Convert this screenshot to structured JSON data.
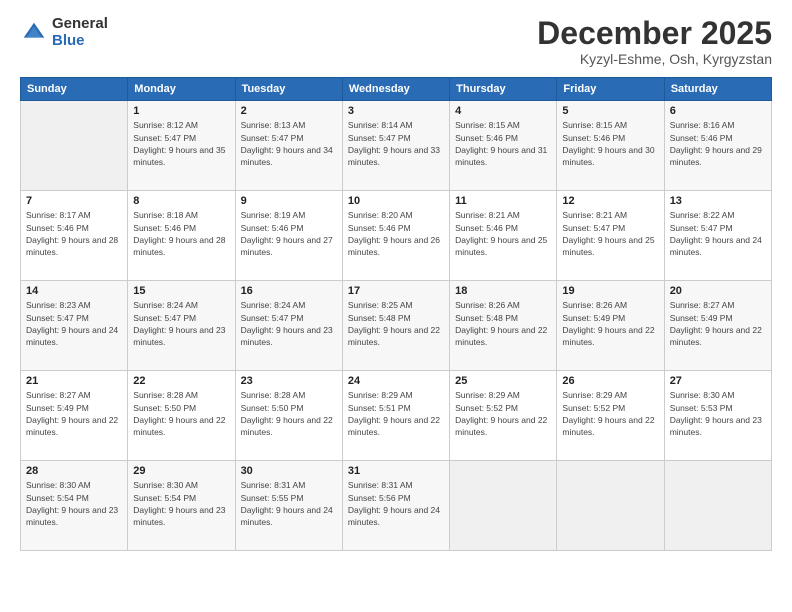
{
  "header": {
    "logo_general": "General",
    "logo_blue": "Blue",
    "title": "December 2025",
    "subtitle": "Kyzyl-Eshme, Osh, Kyrgyzstan"
  },
  "days_of_week": [
    "Sunday",
    "Monday",
    "Tuesday",
    "Wednesday",
    "Thursday",
    "Friday",
    "Saturday"
  ],
  "weeks": [
    [
      {
        "day": "",
        "sunrise": "",
        "sunset": "",
        "daylight": "",
        "empty": true
      },
      {
        "day": "1",
        "sunrise": "Sunrise: 8:12 AM",
        "sunset": "Sunset: 5:47 PM",
        "daylight": "Daylight: 9 hours and 35 minutes."
      },
      {
        "day": "2",
        "sunrise": "Sunrise: 8:13 AM",
        "sunset": "Sunset: 5:47 PM",
        "daylight": "Daylight: 9 hours and 34 minutes."
      },
      {
        "day": "3",
        "sunrise": "Sunrise: 8:14 AM",
        "sunset": "Sunset: 5:47 PM",
        "daylight": "Daylight: 9 hours and 33 minutes."
      },
      {
        "day": "4",
        "sunrise": "Sunrise: 8:15 AM",
        "sunset": "Sunset: 5:46 PM",
        "daylight": "Daylight: 9 hours and 31 minutes."
      },
      {
        "day": "5",
        "sunrise": "Sunrise: 8:15 AM",
        "sunset": "Sunset: 5:46 PM",
        "daylight": "Daylight: 9 hours and 30 minutes."
      },
      {
        "day": "6",
        "sunrise": "Sunrise: 8:16 AM",
        "sunset": "Sunset: 5:46 PM",
        "daylight": "Daylight: 9 hours and 29 minutes."
      }
    ],
    [
      {
        "day": "7",
        "sunrise": "Sunrise: 8:17 AM",
        "sunset": "Sunset: 5:46 PM",
        "daylight": "Daylight: 9 hours and 28 minutes."
      },
      {
        "day": "8",
        "sunrise": "Sunrise: 8:18 AM",
        "sunset": "Sunset: 5:46 PM",
        "daylight": "Daylight: 9 hours and 28 minutes."
      },
      {
        "day": "9",
        "sunrise": "Sunrise: 8:19 AM",
        "sunset": "Sunset: 5:46 PM",
        "daylight": "Daylight: 9 hours and 27 minutes."
      },
      {
        "day": "10",
        "sunrise": "Sunrise: 8:20 AM",
        "sunset": "Sunset: 5:46 PM",
        "daylight": "Daylight: 9 hours and 26 minutes."
      },
      {
        "day": "11",
        "sunrise": "Sunrise: 8:21 AM",
        "sunset": "Sunset: 5:46 PM",
        "daylight": "Daylight: 9 hours and 25 minutes."
      },
      {
        "day": "12",
        "sunrise": "Sunrise: 8:21 AM",
        "sunset": "Sunset: 5:47 PM",
        "daylight": "Daylight: 9 hours and 25 minutes."
      },
      {
        "day": "13",
        "sunrise": "Sunrise: 8:22 AM",
        "sunset": "Sunset: 5:47 PM",
        "daylight": "Daylight: 9 hours and 24 minutes."
      }
    ],
    [
      {
        "day": "14",
        "sunrise": "Sunrise: 8:23 AM",
        "sunset": "Sunset: 5:47 PM",
        "daylight": "Daylight: 9 hours and 24 minutes."
      },
      {
        "day": "15",
        "sunrise": "Sunrise: 8:24 AM",
        "sunset": "Sunset: 5:47 PM",
        "daylight": "Daylight: 9 hours and 23 minutes."
      },
      {
        "day": "16",
        "sunrise": "Sunrise: 8:24 AM",
        "sunset": "Sunset: 5:47 PM",
        "daylight": "Daylight: 9 hours and 23 minutes."
      },
      {
        "day": "17",
        "sunrise": "Sunrise: 8:25 AM",
        "sunset": "Sunset: 5:48 PM",
        "daylight": "Daylight: 9 hours and 22 minutes."
      },
      {
        "day": "18",
        "sunrise": "Sunrise: 8:26 AM",
        "sunset": "Sunset: 5:48 PM",
        "daylight": "Daylight: 9 hours and 22 minutes."
      },
      {
        "day": "19",
        "sunrise": "Sunrise: 8:26 AM",
        "sunset": "Sunset: 5:49 PM",
        "daylight": "Daylight: 9 hours and 22 minutes."
      },
      {
        "day": "20",
        "sunrise": "Sunrise: 8:27 AM",
        "sunset": "Sunset: 5:49 PM",
        "daylight": "Daylight: 9 hours and 22 minutes."
      }
    ],
    [
      {
        "day": "21",
        "sunrise": "Sunrise: 8:27 AM",
        "sunset": "Sunset: 5:49 PM",
        "daylight": "Daylight: 9 hours and 22 minutes."
      },
      {
        "day": "22",
        "sunrise": "Sunrise: 8:28 AM",
        "sunset": "Sunset: 5:50 PM",
        "daylight": "Daylight: 9 hours and 22 minutes."
      },
      {
        "day": "23",
        "sunrise": "Sunrise: 8:28 AM",
        "sunset": "Sunset: 5:50 PM",
        "daylight": "Daylight: 9 hours and 22 minutes."
      },
      {
        "day": "24",
        "sunrise": "Sunrise: 8:29 AM",
        "sunset": "Sunset: 5:51 PM",
        "daylight": "Daylight: 9 hours and 22 minutes."
      },
      {
        "day": "25",
        "sunrise": "Sunrise: 8:29 AM",
        "sunset": "Sunset: 5:52 PM",
        "daylight": "Daylight: 9 hours and 22 minutes."
      },
      {
        "day": "26",
        "sunrise": "Sunrise: 8:29 AM",
        "sunset": "Sunset: 5:52 PM",
        "daylight": "Daylight: 9 hours and 22 minutes."
      },
      {
        "day": "27",
        "sunrise": "Sunrise: 8:30 AM",
        "sunset": "Sunset: 5:53 PM",
        "daylight": "Daylight: 9 hours and 23 minutes."
      }
    ],
    [
      {
        "day": "28",
        "sunrise": "Sunrise: 8:30 AM",
        "sunset": "Sunset: 5:54 PM",
        "daylight": "Daylight: 9 hours and 23 minutes."
      },
      {
        "day": "29",
        "sunrise": "Sunrise: 8:30 AM",
        "sunset": "Sunset: 5:54 PM",
        "daylight": "Daylight: 9 hours and 23 minutes."
      },
      {
        "day": "30",
        "sunrise": "Sunrise: 8:31 AM",
        "sunset": "Sunset: 5:55 PM",
        "daylight": "Daylight: 9 hours and 24 minutes."
      },
      {
        "day": "31",
        "sunrise": "Sunrise: 8:31 AM",
        "sunset": "Sunset: 5:56 PM",
        "daylight": "Daylight: 9 hours and 24 minutes."
      },
      {
        "day": "",
        "sunrise": "",
        "sunset": "",
        "daylight": "",
        "empty": true
      },
      {
        "day": "",
        "sunrise": "",
        "sunset": "",
        "daylight": "",
        "empty": true
      },
      {
        "day": "",
        "sunrise": "",
        "sunset": "",
        "daylight": "",
        "empty": true
      }
    ]
  ]
}
